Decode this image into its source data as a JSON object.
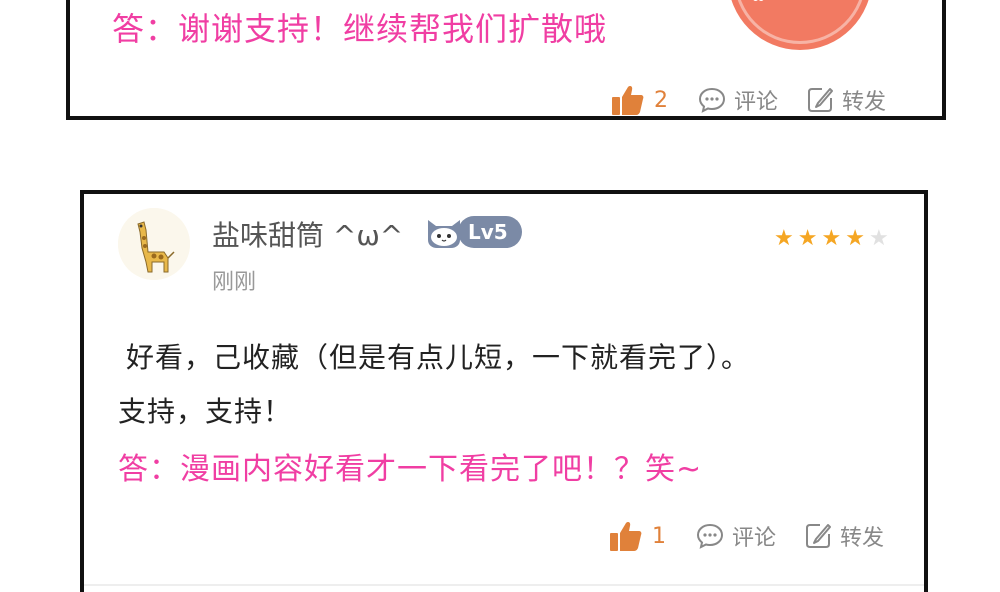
{
  "top_card": {
    "reply_text": "答：谢谢支持！继续帮我们扩散哦",
    "like_count": "2",
    "comment_label": "评论",
    "share_label": "转发"
  },
  "bottom_card": {
    "username": "盐味甜筒 ^ω^",
    "level": "Lv5",
    "time": "刚刚",
    "rating": 4,
    "rating_max": 5,
    "comment_line1": "好看，己收藏（但是有点儿短，一下就看完了）。",
    "comment_line2": "支持，支持！",
    "reply_text": "答：漫画内容好看才一下看完了吧！？笑~",
    "like_count": "1",
    "comment_label": "评论",
    "share_label": "转发"
  },
  "colors": {
    "reply": "#f03ea3",
    "like": "#e0813a",
    "star": "#f5a623",
    "level_badge": "#7b8aa6",
    "border": "#111111"
  },
  "icons": [
    "thumbs-up-icon",
    "comment-bubble-icon",
    "share-edit-icon",
    "star-icon",
    "level-cat-icon",
    "giraffe-avatar"
  ]
}
